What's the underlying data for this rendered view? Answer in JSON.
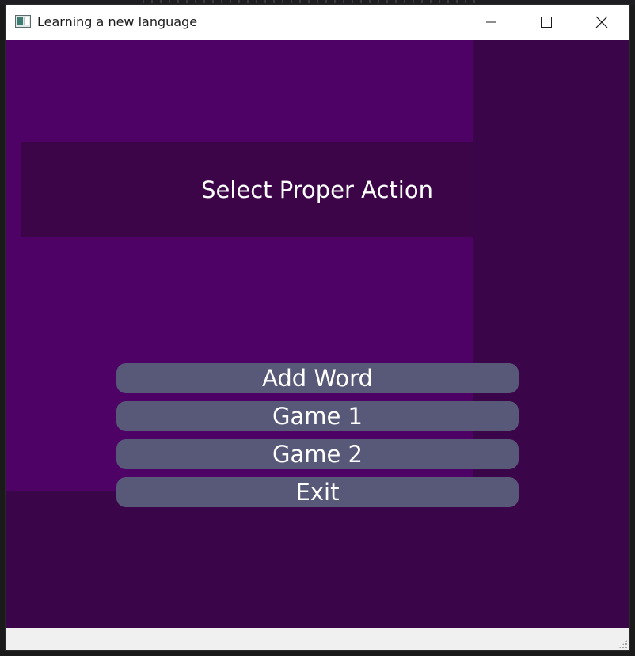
{
  "window": {
    "title": "Learning a new language",
    "controls": {
      "minimize": "minimize",
      "maximize": "maximize",
      "close": "close"
    }
  },
  "header": {
    "title": "Select Proper Action"
  },
  "menu": {
    "items": [
      {
        "label": "Add Word"
      },
      {
        "label": "Game 1"
      },
      {
        "label": "Game 2"
      },
      {
        "label": "Exit"
      }
    ]
  },
  "colors": {
    "background": "#3a0549",
    "panel": "#4e0266",
    "button": "#585879",
    "text": "#ffffff"
  }
}
